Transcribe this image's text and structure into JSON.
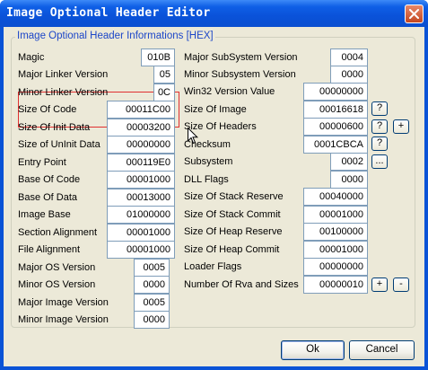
{
  "window": {
    "title": "Image Optional Header Editor"
  },
  "group": {
    "caption": "Image Optional Header Informations [HEX]"
  },
  "left_fields": [
    {
      "label": "Magic",
      "value": "010B"
    },
    {
      "label": "Major Linker Version",
      "value": "05"
    },
    {
      "label": "Minor Linker Version",
      "value": "0C"
    },
    {
      "label": "Size Of Code",
      "value": "00011C00"
    },
    {
      "label": "Size Of Init Data",
      "value": "00003200"
    },
    {
      "label": "Size of UnInit Data",
      "value": "00000000"
    },
    {
      "label": "Entry Point",
      "value": "000119E0"
    },
    {
      "label": "Base Of Code",
      "value": "00001000"
    },
    {
      "label": "Base Of Data",
      "value": "00013000"
    },
    {
      "label": "Image Base",
      "value": "01000000"
    },
    {
      "label": "Section Alignment",
      "value": "00001000"
    },
    {
      "label": "File Alignment",
      "value": "00001000"
    },
    {
      "label": "Major OS Version",
      "value": "0005"
    },
    {
      "label": "Minor OS Version",
      "value": "0000"
    },
    {
      "label": "Major Image Version",
      "value": "0005"
    },
    {
      "label": "Minor Image Version",
      "value": "0000"
    }
  ],
  "right_fields": [
    {
      "label": "Major SubSystem Version",
      "value": "0004"
    },
    {
      "label": "Minor Subsystem Version",
      "value": "0000"
    },
    {
      "label": "Win32 Version Value",
      "value": "00000000"
    },
    {
      "label": "Size Of Image",
      "value": "00016618"
    },
    {
      "label": "Size Of Headers",
      "value": "00000600"
    },
    {
      "label": "Checksum",
      "value": "0001CBCA"
    },
    {
      "label": "Subsystem",
      "value": "0002"
    },
    {
      "label": "DLL Flags",
      "value": "0000"
    },
    {
      "label": "Size Of Stack Reserve",
      "value": "00040000"
    },
    {
      "label": "Size Of Stack Commit",
      "value": "00001000"
    },
    {
      "label": "Size Of Heap Reserve",
      "value": "00100000"
    },
    {
      "label": "Size Of Heap Commit",
      "value": "00001000"
    },
    {
      "label": "Loader Flags",
      "value": "00000000"
    },
    {
      "label": "Number Of Rva and Sizes",
      "value": "00000010"
    }
  ],
  "small_buttons": {
    "size_of_image_help": "?",
    "size_of_headers_help": "?",
    "size_of_headers_plus": "+",
    "checksum_help": "?",
    "subsystem_browse": "...",
    "rva_plus": "+",
    "rva_minus": "-"
  },
  "buttons": {
    "ok": "Ok",
    "cancel": "Cancel"
  },
  "colors": {
    "title_bar": "#0a52d9",
    "dialog_bg": "#ece9d8",
    "group_caption": "#1c46c8",
    "highlight_border": "#e03030",
    "field_border": "#7f9db9"
  }
}
